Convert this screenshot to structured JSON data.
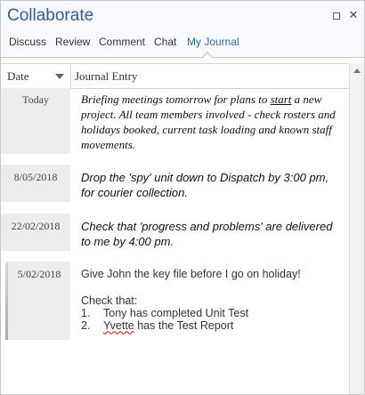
{
  "window": {
    "title": "Collaborate"
  },
  "tabs": [
    {
      "label": "Discuss"
    },
    {
      "label": "Review"
    },
    {
      "label": "Comment"
    },
    {
      "label": "Chat"
    },
    {
      "label": "My Journal",
      "active": true
    }
  ],
  "columns": {
    "date": "Date",
    "entry": "Journal Entry"
  },
  "entries": [
    {
      "date": "Today",
      "before": "Briefing meetings tomorrow for plans to ",
      "underlined": "start",
      "after": " a new project. All team members involved - check rosters and holidays booked, current task loading and known staff movements."
    },
    {
      "date": "8/05/2018",
      "text": "Drop the 'spy' unit down to Dispatch by 3:00 pm, for courier collection."
    },
    {
      "date": "22/02/2018",
      "text": "Check that 'progress and problems' are delivered to me by 4:00 pm."
    },
    {
      "date": "5/02/2018",
      "line1": "Give John the key file before I go on holiday!",
      "line2": "Check that:",
      "item1_num": "1.",
      "item1_text": "Tony has completed Unit Test",
      "item2_num": "2.",
      "item2_name": "Yvette",
      "item2_rest": " has the Test Report"
    }
  ],
  "colors": {
    "title": "#2e5e93",
    "active_tab": "#2e6aa8",
    "date_cell_bg": "#ededed"
  },
  "icons": [
    "restore-icon",
    "close-icon",
    "sort-down-icon",
    "scroll-up-icon"
  ]
}
